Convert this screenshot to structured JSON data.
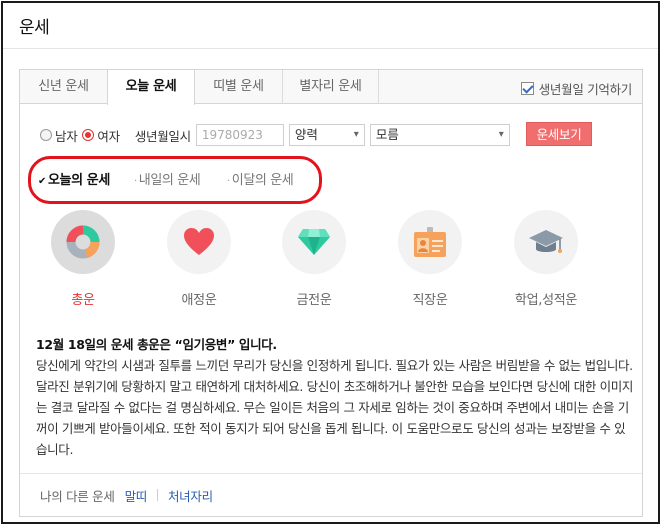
{
  "page": {
    "title": "운세"
  },
  "tabs": [
    {
      "label": "신년 운세",
      "active": false
    },
    {
      "label": "오늘 운세",
      "active": true
    },
    {
      "label": "띠별 운세",
      "active": false
    },
    {
      "label": "별자리 운세",
      "active": false
    }
  ],
  "remember": {
    "label": "생년월일 기억하기",
    "checked": true
  },
  "form": {
    "gender_male": "남자",
    "gender_female": "여자",
    "selected_gender": "여자",
    "birth_label": "생년월일시",
    "birth_placeholder": "19780923",
    "calendar_value": "양력",
    "time_value": "모름",
    "submit_label": "운세보기"
  },
  "subtabs": [
    {
      "label": "오늘의 운세",
      "active": true,
      "mark": "✔"
    },
    {
      "label": "내일의 운세",
      "active": false,
      "mark": "·"
    },
    {
      "label": "이달의 운세",
      "active": false,
      "mark": "·"
    }
  ],
  "categories": [
    {
      "label": "총운",
      "icon": "donut-chart-icon",
      "active": true
    },
    {
      "label": "애정운",
      "icon": "heart-icon",
      "active": false
    },
    {
      "label": "금전운",
      "icon": "diamond-icon",
      "active": false
    },
    {
      "label": "직장운",
      "icon": "id-badge-icon",
      "active": false
    },
    {
      "label": "학업,성적운",
      "icon": "graduation-cap-icon",
      "active": false
    }
  ],
  "fortune": {
    "title": "12월 18일의 운세 총운은 “임기응변” 입니다.",
    "body": "당신에게 약간의 시샘과 질투를 느끼던 무리가 당신을 인정하게 됩니다. 필요가 있는 사람은 버림받을 수 없는 법입니다. 달라진 분위기에 당황하지 말고 태연하게 대처하세요. 당신이 초조해하거나 불안한 모습을 보인다면 당신에 대한 이미지는 결코 달라질 수 없다는 걸 명심하세요. 무슨 일이든 처음의 그 자세로 임하는 것이 중요하며 주변에서 내미는 손을 기꺼이 기쁘게 받아들이세요. 또한 적이 동지가 되어 당신을 돕게 됩니다. 이 도움만으로도 당신의 성과는 보장받을 수 있습니다."
  },
  "footer": {
    "label": "나의 다른 운세",
    "links": [
      "말띠",
      "처녀자리"
    ]
  },
  "colors": {
    "accent_red": "#e23434",
    "button_red": "#f06e6e",
    "link_blue": "#2a5db0",
    "heart_red": "#f0505a",
    "diamond_teal": "#2fc9a0",
    "badge_orange": "#f7a25a",
    "cap_gray": "#8a9aa8"
  }
}
